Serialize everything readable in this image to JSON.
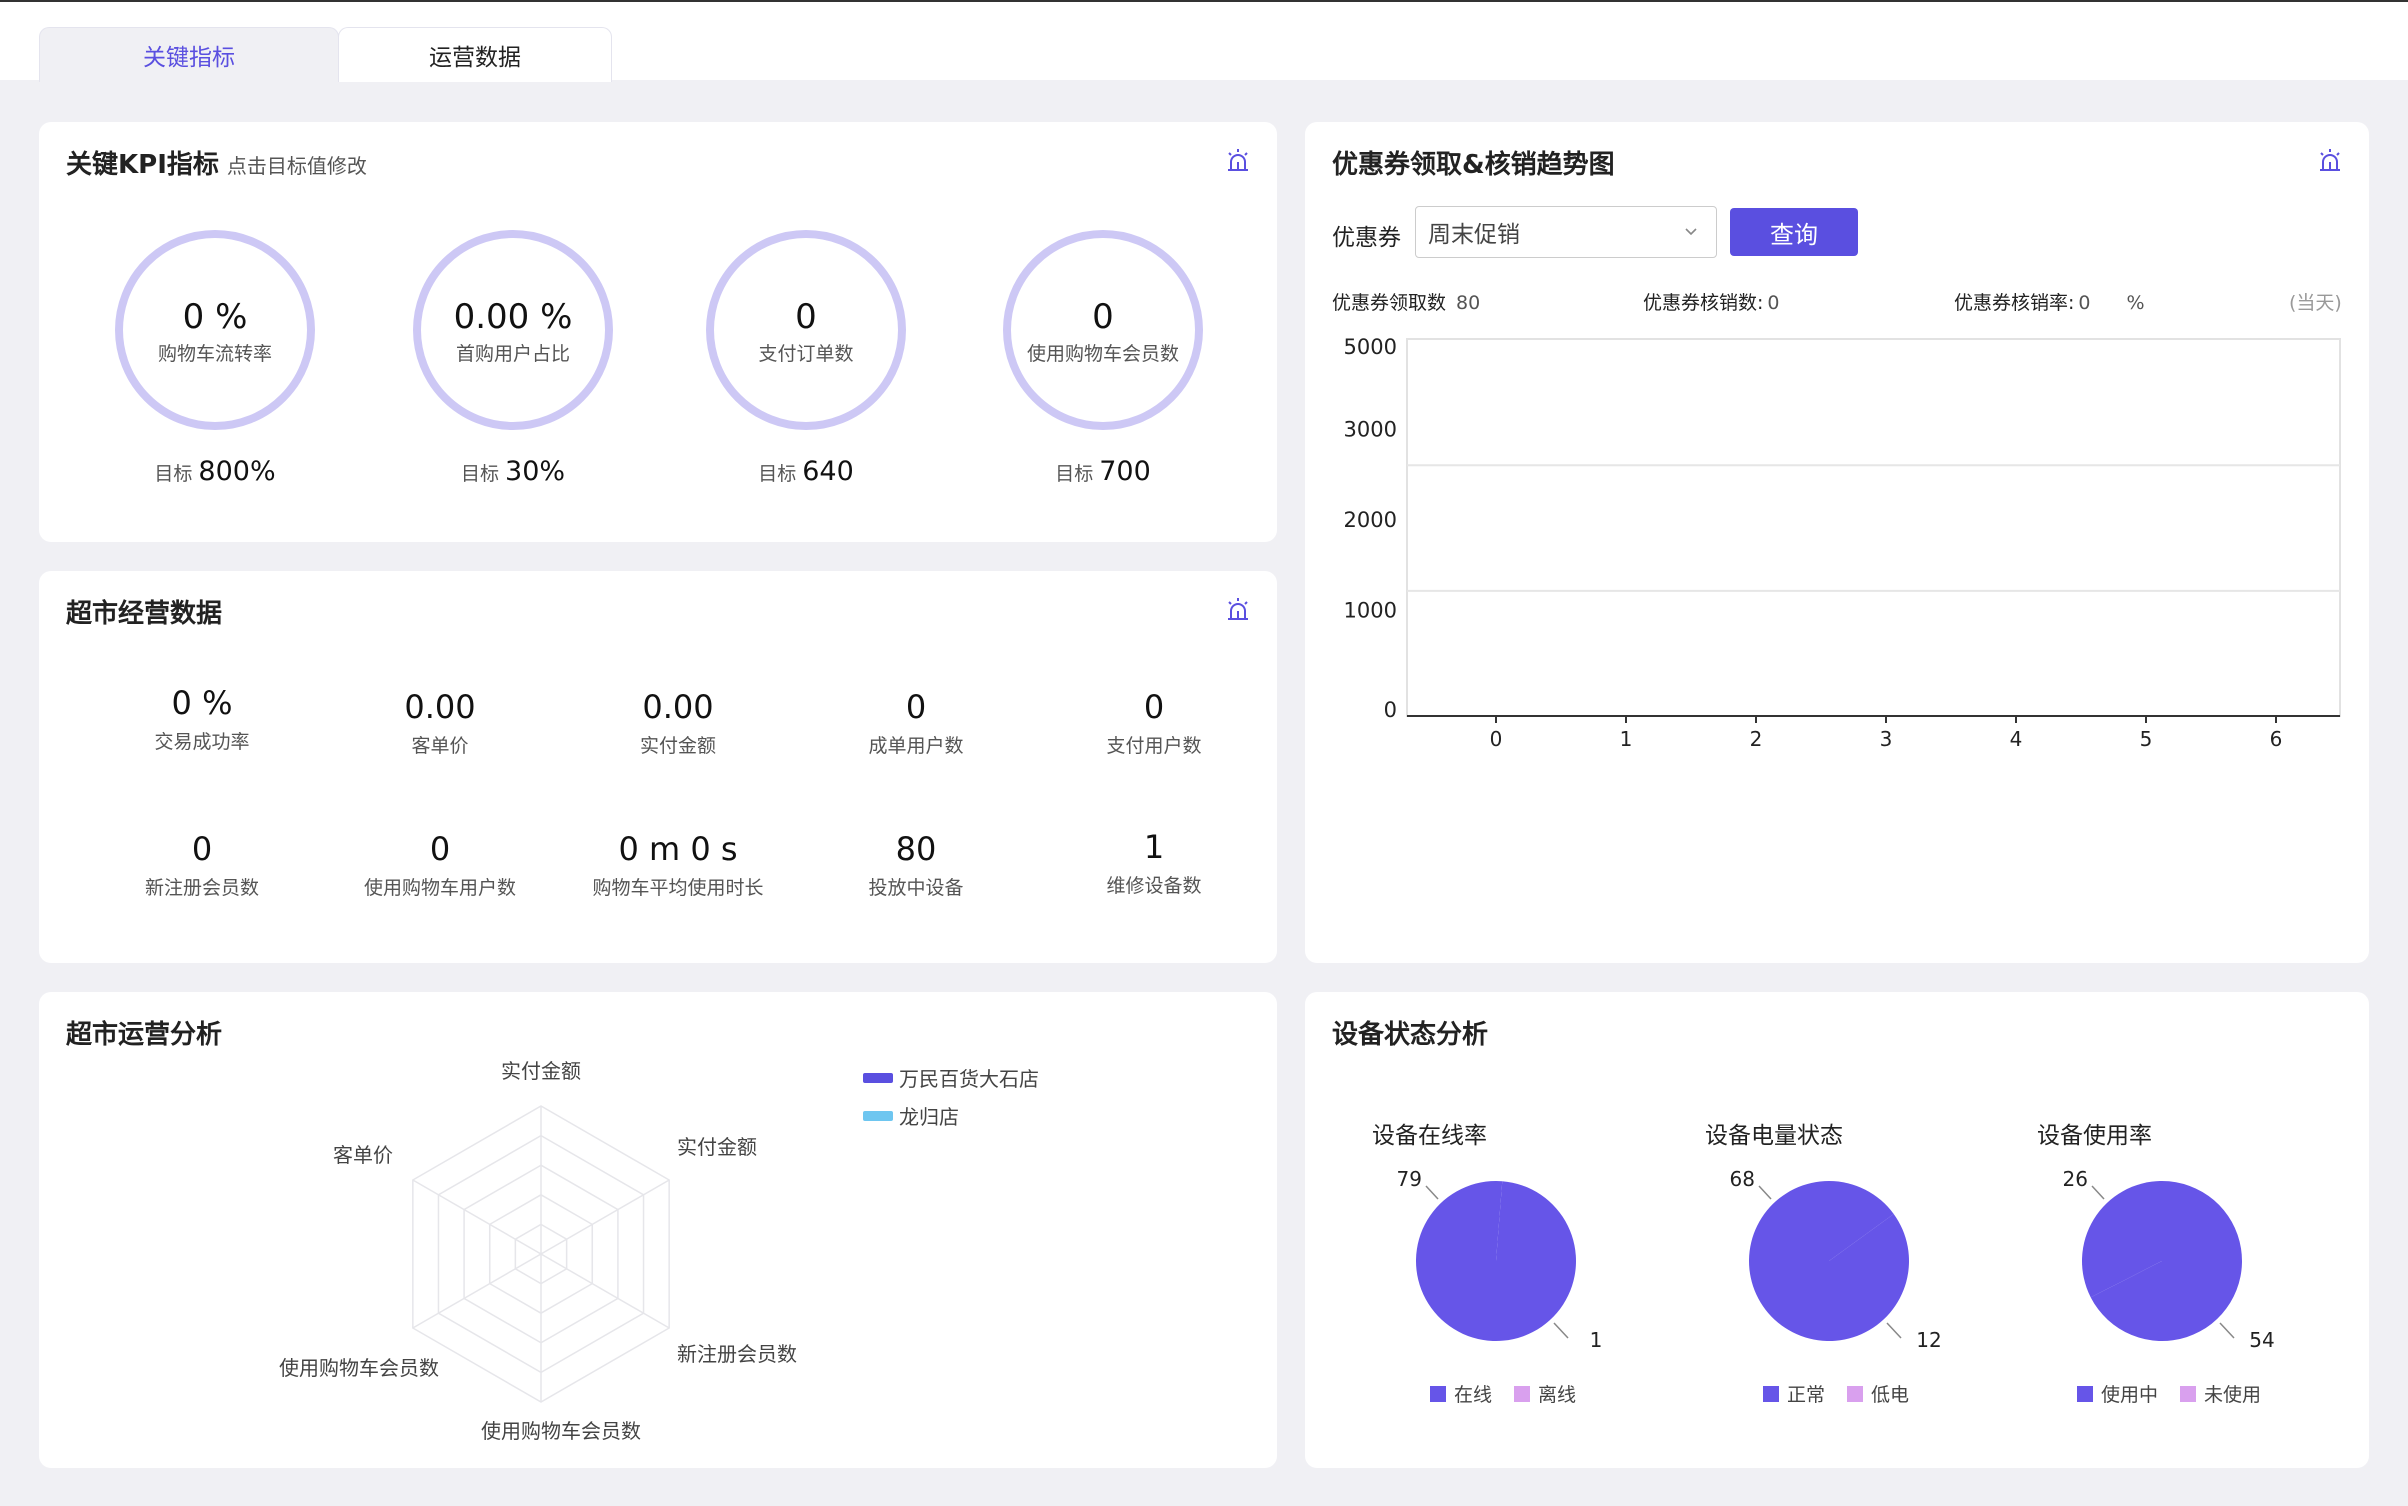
{
  "tabs": [
    {
      "label": "关键指标"
    },
    {
      "label": "运营数据"
    }
  ],
  "kpi": {
    "title": "关键KPI指标",
    "subtitle": "点击目标值修改",
    "target_prefix": "目标",
    "items": [
      {
        "value": "0 %",
        "label": "购物车流转率",
        "target": "800%"
      },
      {
        "value": "0.00 %",
        "label": "首购用户占比",
        "target": "30%"
      },
      {
        "value": "0",
        "label": "支付订单数",
        "target": "640"
      },
      {
        "value": "0",
        "label": "使用购物车会员数",
        "target": "700"
      }
    ]
  },
  "ops": {
    "title": "超市经营数据",
    "items": [
      {
        "value": "0 %",
        "label": "交易成功率"
      },
      {
        "value": "0.00",
        "label": "客单价"
      },
      {
        "value": "0.00",
        "label": "实付金额"
      },
      {
        "value": "0",
        "label": "成单用户数"
      },
      {
        "value": "0",
        "label": "支付用户数"
      },
      {
        "value": "0",
        "label": "新注册会员数"
      },
      {
        "value": "0",
        "label": "使用购物车用户数"
      },
      {
        "value": "0 m 0 s",
        "label": "购物车平均使用时长"
      },
      {
        "value": "80",
        "label": "投放中设备"
      },
      {
        "value": "1",
        "label": "维修设备数"
      }
    ]
  },
  "coupon": {
    "title": "优惠券领取&核销趋势图",
    "select_label": "优惠券",
    "select_value": "周末促销",
    "query_label": "查询",
    "stats": [
      {
        "label": "优惠券领取数",
        "value": "80"
      },
      {
        "label": "优惠券核销数:",
        "value": "0"
      },
      {
        "label": "优惠券核销率:",
        "value": "0",
        "unit": "%"
      }
    ],
    "period": "(当天)"
  },
  "analysis": {
    "title": "超市运营分析",
    "axes": [
      "实付金额",
      "实付金额",
      "新注册会员数",
      "使用购物车会员数",
      "使用购物车会员数",
      "客单价"
    ],
    "legend": [
      {
        "name": "万民百货大石店",
        "color": "#5a4fe0"
      },
      {
        "name": "龙归店",
        "color": "#6ec6f0"
      }
    ]
  },
  "device": {
    "title": "设备状态分析",
    "pies": [
      {
        "title": "设备在线率",
        "a_label": "在线",
        "b_label": "离线",
        "a": 79,
        "b": 1,
        "a_text": "79",
        "b_text": "1"
      },
      {
        "title": "设备电量状态",
        "a_label": "正常",
        "b_label": "低电",
        "a": 68,
        "b": 12,
        "a_text": "68",
        "b_text": "12"
      },
      {
        "title": "设备使用率",
        "a_label": "使用中",
        "b_label": "未使用",
        "a": 26,
        "b": 54,
        "a_text": "26",
        "b_text": "54"
      }
    ],
    "colors": {
      "primary": "#6655e8",
      "secondary": "#d9a0ee"
    }
  },
  "chart_data": {
    "type": "line",
    "x": [
      "0",
      "1",
      "2",
      "3",
      "4",
      "5",
      "6"
    ],
    "yticks": [
      "5000",
      "3000",
      "2000",
      "1000",
      "0"
    ],
    "series": [],
    "ylim": [
      0,
      5000
    ]
  },
  "accent_color": "#5a4fe0",
  "ring_color": "#cdc8f5"
}
